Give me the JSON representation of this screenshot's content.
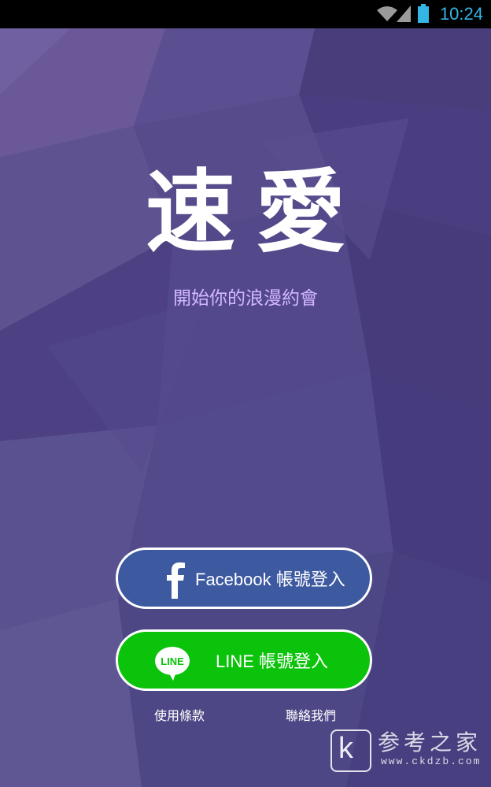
{
  "status_bar": {
    "time": "10:24",
    "icons": [
      "wifi-icon",
      "signal-icon",
      "battery-icon"
    ],
    "accent_color": "#33b5e5"
  },
  "app": {
    "title": "速愛",
    "tagline": "開始你的浪漫約會"
  },
  "buttons": {
    "facebook": {
      "label": "Facebook 帳號登入",
      "icon": "facebook-icon",
      "color": "#3d5aa0"
    },
    "line": {
      "label": "LINE 帳號登入",
      "icon": "line-icon",
      "icon_text": "LINE",
      "color": "#0bc30b"
    }
  },
  "footer": {
    "terms": "使用條款",
    "contact": "聯絡我們"
  },
  "watermark": {
    "letter": "k",
    "text": "参考之家",
    "url": "www.ckdzb.com"
  },
  "colors": {
    "background": "#4e4780",
    "tagline": "#d3b7ff"
  }
}
